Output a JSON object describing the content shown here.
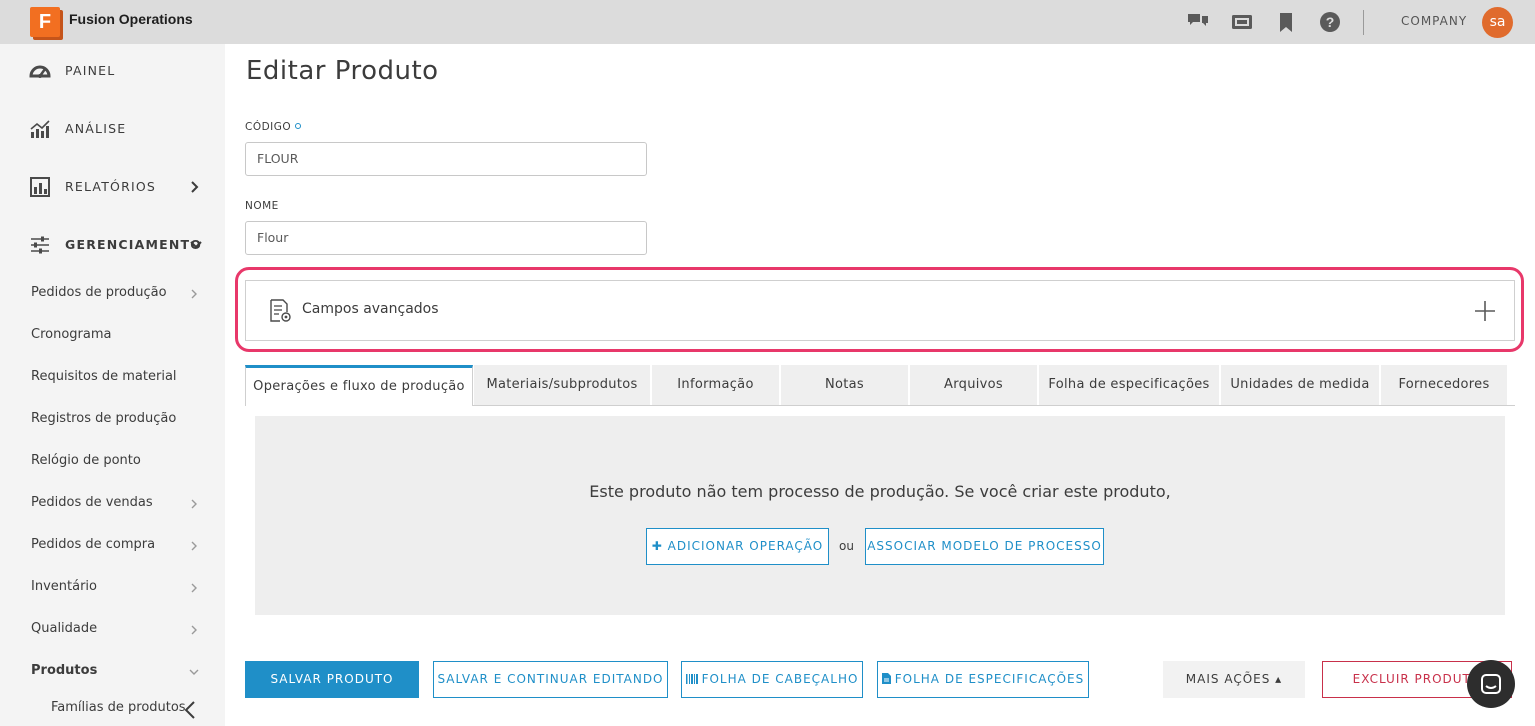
{
  "app": {
    "title": "Fusion Operations",
    "logo_letter": "F",
    "company": "COMPANY",
    "avatar_initials": "sa"
  },
  "topbar": {
    "icons": [
      "chat-icon",
      "kiosk-icon",
      "bookmark-icon",
      "help-icon"
    ]
  },
  "sidebar": {
    "main": [
      {
        "label": "PAINEL",
        "icon": "dashboard-icon"
      },
      {
        "label": "ANÁLISE",
        "icon": "analytics-icon"
      },
      {
        "label": "RELATÓRIOS",
        "icon": "reports-icon"
      },
      {
        "label": "GERENCIAMENTO",
        "icon": "sliders-icon"
      }
    ],
    "sub": [
      {
        "label": "Pedidos de produção"
      },
      {
        "label": "Cronograma"
      },
      {
        "label": "Requisitos de material"
      },
      {
        "label": "Registros de produção"
      },
      {
        "label": "Relógio de ponto"
      },
      {
        "label": "Pedidos de vendas"
      },
      {
        "label": "Pedidos de compra"
      },
      {
        "label": "Inventário"
      },
      {
        "label": "Qualidade"
      },
      {
        "label": "Produtos"
      },
      {
        "label": "Famílias de produtos"
      }
    ]
  },
  "page": {
    "title": "Editar Produto"
  },
  "form": {
    "code_label": "CÓDIGO",
    "code_value": "FLOUR",
    "name_label": "NOME",
    "name_value": "Flour"
  },
  "advanced": {
    "label": "Campos avançados"
  },
  "tabs": [
    "Operações e fluxo de produção",
    "Materiais/subprodutos",
    "Informação",
    "Notas",
    "Arquivos",
    "Folha de especificações",
    "Unidades de medida",
    "Fornecedores"
  ],
  "empty_state": {
    "message": "Este produto não tem processo de produção. Se você criar este produto,",
    "add_operation": "✚ ADICIONAR OPERAÇÃO",
    "or": "ou",
    "associate_template": "ASSOCIAR MODELO DE PROCESSO"
  },
  "footer": {
    "save": "SALVAR PRODUTO",
    "save_continue": "SALVAR E CONTINUAR EDITANDO",
    "header_sheet": "FOLHA DE CABEÇALHO",
    "spec_sheet": "FOLHA DE ESPECIFICAÇÕES",
    "more_actions": "MAIS AÇÕES ▴",
    "delete": "EXCLUIR PRODUTO"
  },
  "colors": {
    "accent": "#1f8fc8",
    "highlight": "#e8386a",
    "brand": "#f26f21",
    "danger": "#c8304a"
  }
}
